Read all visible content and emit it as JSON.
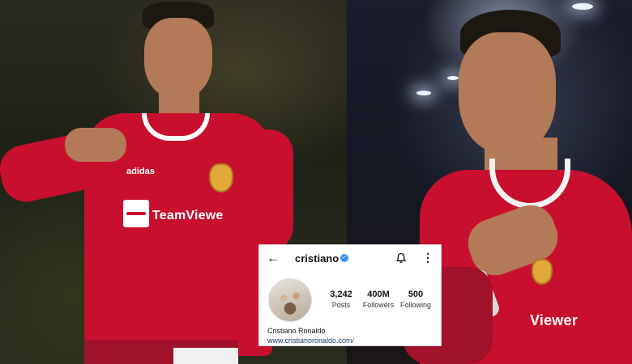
{
  "profile": {
    "username": "cristiano",
    "verified": true,
    "posts_value": "3,242",
    "posts_label": "Posts",
    "followers_value": "400M",
    "followers_label": "Followers",
    "following_value": "500",
    "following_label": "Following",
    "display_name": "Cristiano Ronaldo",
    "website": "www.cristianoronaldo.com/"
  },
  "left_photo": {
    "sponsor": "TeamViewe",
    "kit_brand": "adidas"
  },
  "right_photo": {
    "sponsor": "Viewer"
  },
  "icons": {
    "back": "back-arrow-icon",
    "verified": "verified-badge-icon",
    "notifications": "bell-icon",
    "more": "more-options-icon"
  },
  "colors": {
    "jersey_red": "#c8102e",
    "verified_blue": "#3897f0",
    "card_background": "#ffffff"
  }
}
